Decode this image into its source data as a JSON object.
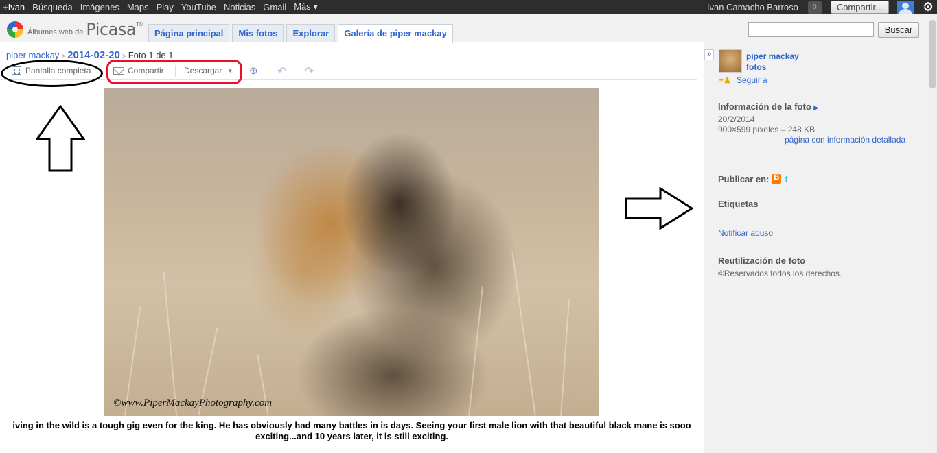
{
  "gbar": {
    "links": [
      "+Ivan",
      "Búsqueda",
      "Imágenes",
      "Maps",
      "Play",
      "YouTube",
      "Noticias",
      "Gmail",
      "Más ▾"
    ],
    "username": "Ivan Camacho Barroso",
    "notifications": "0",
    "share_label": "Compartir..."
  },
  "header": {
    "logo_prefix": "Álbumes web de",
    "logo_name": "Picasa",
    "logo_tm": "TM",
    "tabs": [
      "Página principal",
      "Mis fotos",
      "Explorar",
      "Galería de piper mackay"
    ],
    "active_tab": 3,
    "search_value": "",
    "search_button": "Buscar"
  },
  "breadcrumb": {
    "user": "piper mackay",
    "album": "2014-02-20",
    "position": "Foto 1 de 1",
    "separator": ">"
  },
  "toolbar": {
    "fullscreen": "Pantalla completa",
    "share": "Compartir",
    "download": "Descargar"
  },
  "photo": {
    "watermark": "©www.PiperMackayPhotography.com"
  },
  "caption": "iving in the wild is a tough gig even for the king. He has obviously had many battles in is days. Seeing your first male lion with that beautiful black mane is sooo exciting...and 10 years later, it is still exciting.",
  "sidebar": {
    "owner_name": "piper mackay",
    "owner_photos": "fotos",
    "follow": "Seguir a",
    "info_title": "Información de la foto",
    "date": "20/2/2014",
    "dimensions": "900×599 píxeles – 248 KB",
    "details_link": "página con información detallada",
    "publish_label": "Publicar en:",
    "tags_label": "Etiquetas",
    "report": "Notificar abuso",
    "reuse_title": "Reutilización de foto",
    "copyright": "©Reservados todos los derechos."
  },
  "colors": {
    "link": "#3366cc",
    "annotation_red": "#e8102a",
    "annotation_black": "#000000",
    "gbar": "#2d2d2d"
  }
}
